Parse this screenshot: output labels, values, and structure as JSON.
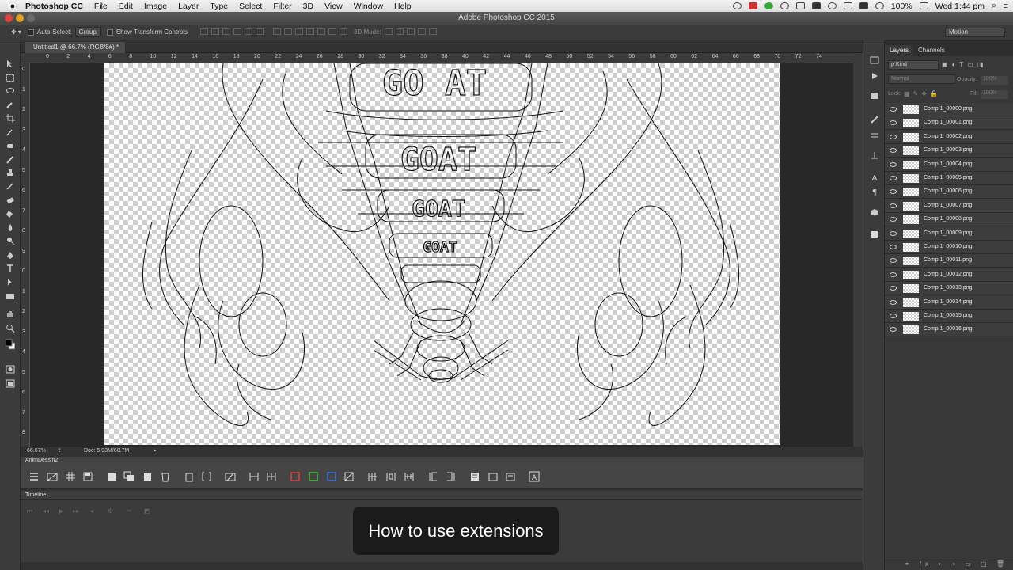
{
  "menubar": {
    "apple": "",
    "app_name": "Photoshop CC",
    "items": [
      "File",
      "Edit",
      "Image",
      "Layer",
      "Type",
      "Select",
      "Filter",
      "3D",
      "View",
      "Window",
      "Help"
    ],
    "battery": "100%",
    "clock": "Wed 1:44 pm"
  },
  "window": {
    "title": "Adobe Photoshop CC 2015"
  },
  "options": {
    "auto_select_label": "Auto-Select:",
    "auto_select_value": "Group",
    "transform_label": "Show Transform Controls",
    "mode_label": "3D Mode:",
    "workspace": "Motion"
  },
  "document": {
    "tab_title": "Untitled1 @ 66.7% (RGB/8#) *",
    "zoom": "66.67%",
    "doc_size": "Doc: 5.93M/68.7M",
    "canvas_text": [
      "GO AT",
      "GOAT",
      "GOAT",
      "GOAT"
    ]
  },
  "rulers": {
    "h": [
      "0",
      "2",
      "4",
      "6",
      "8",
      "10",
      "12",
      "14",
      "16",
      "18",
      "20",
      "22",
      "24",
      "26",
      "28",
      "30",
      "32",
      "34",
      "36",
      "38",
      "40",
      "42",
      "44",
      "46",
      "48",
      "50",
      "52",
      "54",
      "56",
      "58",
      "60",
      "62",
      "64",
      "66",
      "68",
      "70",
      "72",
      "74"
    ],
    "v": [
      "0",
      "1",
      "2",
      "3",
      "4",
      "5",
      "6",
      "7",
      "8",
      "9",
      "0",
      "1",
      "2",
      "3",
      "4",
      "5",
      "6",
      "7",
      "8"
    ]
  },
  "panels": {
    "anim_title": "AnimDessin2",
    "timeline_title": "Timeline"
  },
  "layers": {
    "tabs": [
      "Layers",
      "Channels"
    ],
    "kind": "ρ Kind",
    "blend": "Normal",
    "opacity_label": "Opacity:",
    "opacity_value": "100%",
    "lock_label": "Lock:",
    "fill_label": "Fill:",
    "fill_value": "100%",
    "items": [
      "Comp 1_00000.png",
      "Comp 1_00001.png",
      "Comp 1_00002.png",
      "Comp 1_00003.png",
      "Comp 1_00004.png",
      "Comp 1_00005.png",
      "Comp 1_00006.png",
      "Comp 1_00007.png",
      "Comp 1_00008.png",
      "Comp 1_00009.png",
      "Comp 1_00010.png",
      "Comp 1_00011.png",
      "Comp 1_00012.png",
      "Comp 1_00013.png",
      "Comp 1_00014.png",
      "Comp 1_00015.png",
      "Comp 1_00016.png"
    ]
  },
  "caption": "How to use extensions",
  "colors": {
    "accent": "#4a90d9",
    "panel": "#383838",
    "canvas_bg": "#282828"
  }
}
